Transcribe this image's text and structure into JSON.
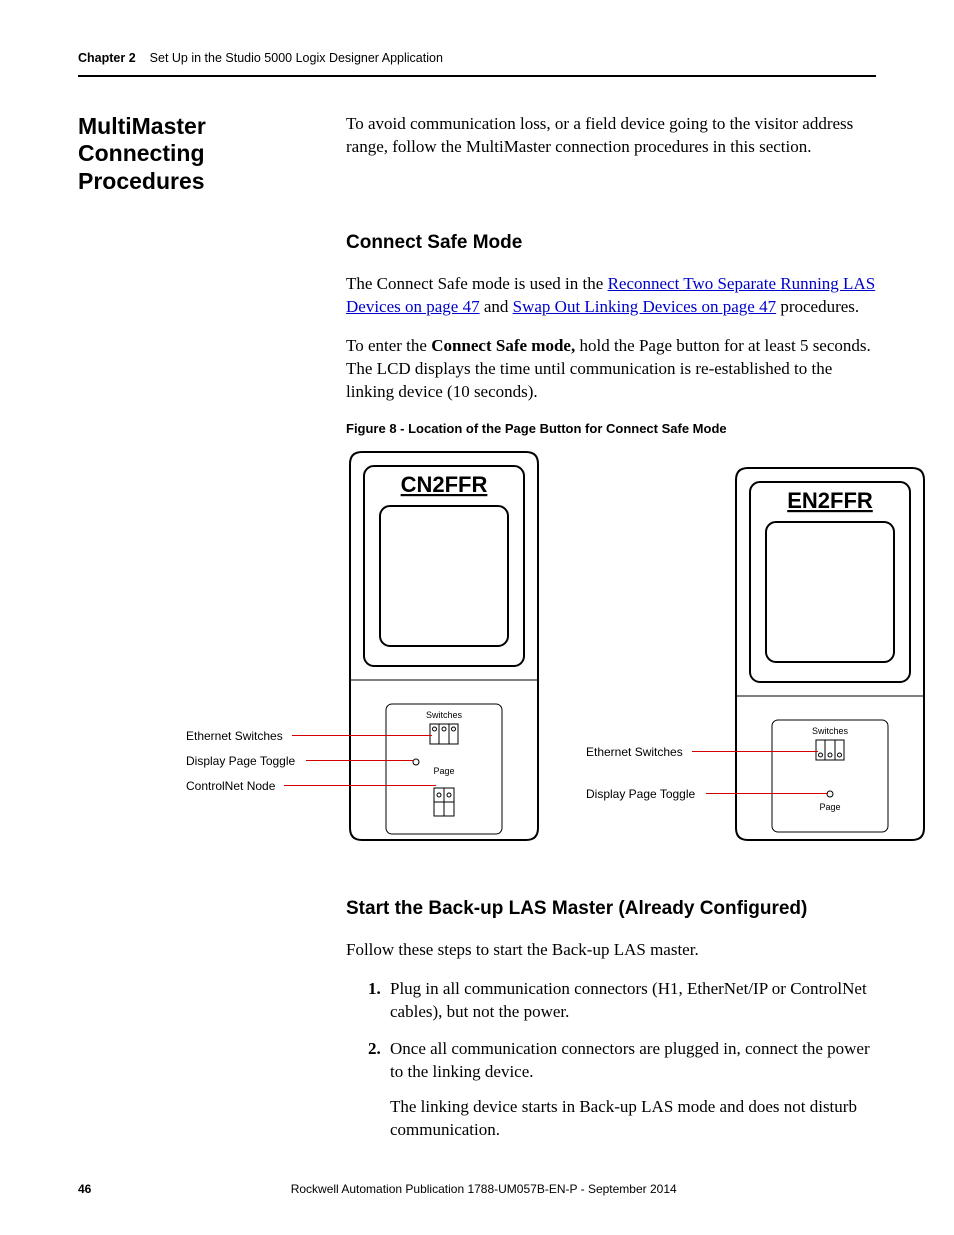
{
  "header": {
    "chapter": "Chapter 2",
    "title": "Set Up in the Studio 5000 Logix Designer Application"
  },
  "sideHeading": "MultiMaster Connecting Procedures",
  "intro": "To avoid communication loss, or a field device going to the visitor address range, follow the MultiMaster connection procedures in this section.",
  "s1": {
    "heading": "Connect Safe Mode",
    "p1a": "The Connect Safe mode is used in the ",
    "link1": "Reconnect Two Separate Running LAS Devices on page 47",
    "p1b": " and ",
    "link2": "Swap Out Linking Devices on page 47",
    "p1c": " procedures.",
    "p2a": "To enter the ",
    "p2bold": "Connect Safe mode,",
    "p2b": " hold the Page button for at least 5 seconds. The LCD displays the time until communication is re-established to the linking device (10 seconds).",
    "figcap": "Figure 8 - Location of the Page Button for Connect Safe Mode"
  },
  "fig": {
    "devA": "CN2FFR",
    "devB": "EN2FFR",
    "lblSwitches": "Switches",
    "lblPage": "Page",
    "callA1": "Ethernet Switches",
    "callA2": "Display Page Toggle",
    "callA3": "ControlNet Node",
    "callB1": "Ethernet Switches",
    "callB2": "Display Page Toggle"
  },
  "s2": {
    "heading": "Start the Back-up LAS Master (Already Configured)",
    "lead": "Follow these steps to start the Back-up LAS master.",
    "step1": "Plug in all communication connectors (H1, EtherNet/IP or ControlNet cables), but not the power.",
    "step2": "Once all communication connectors are plugged in, connect the power to the linking device.",
    "step2note": "The linking device starts in Back-up LAS mode and does not disturb communication."
  },
  "footer": {
    "page": "46",
    "pub": "Rockwell Automation Publication 1788-UM057B-EN-P - September 2014"
  }
}
